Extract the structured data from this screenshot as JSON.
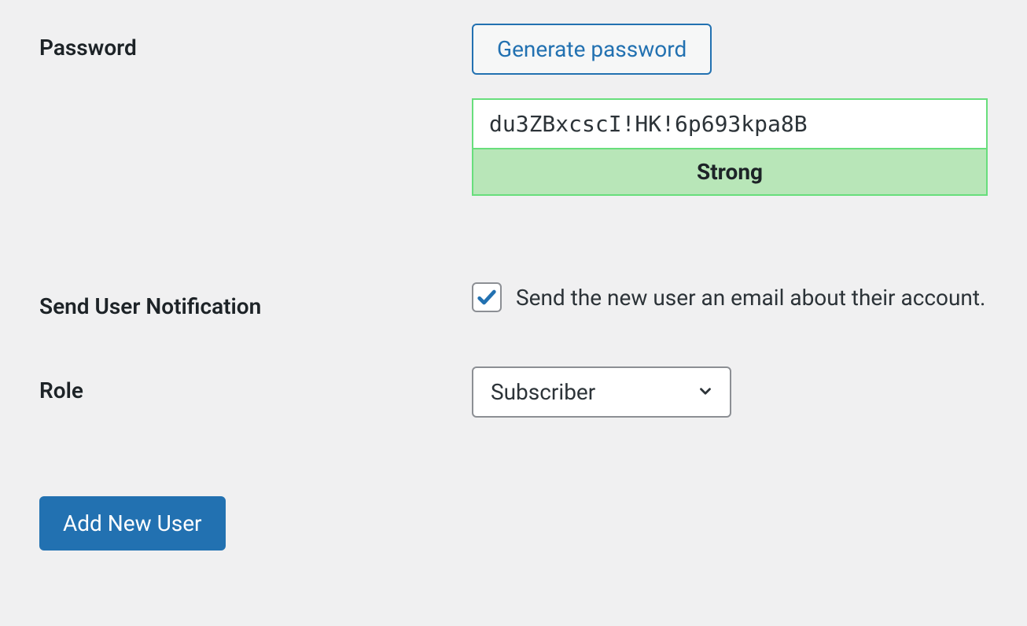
{
  "password": {
    "label": "Password",
    "generate_button": "Generate password",
    "value": "du3ZBxcscI!HK!6p693kpa8B",
    "strength_label": "Strong"
  },
  "notification": {
    "label": "Send User Notification",
    "checked": true,
    "description": "Send the new user an email about their account."
  },
  "role": {
    "label": "Role",
    "selected": "Subscriber"
  },
  "submit": {
    "label": "Add New User"
  }
}
